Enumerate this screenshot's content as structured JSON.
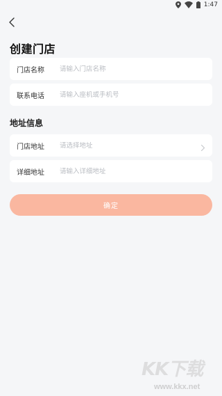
{
  "status_bar": {
    "time": "1:47",
    "icons": [
      "location-icon",
      "wifi-icon",
      "battery-icon"
    ]
  },
  "header": {
    "back_icon": "chevron-left-icon",
    "title": "创建门店"
  },
  "form": {
    "store_name": {
      "label": "门店名称",
      "placeholder": "请输入门店名称",
      "value": ""
    },
    "phone": {
      "label": "联系电话",
      "placeholder": "请输入座机或手机号",
      "value": ""
    }
  },
  "address_section": {
    "title": "地址信息",
    "store_address": {
      "label": "门店地址",
      "placeholder": "请选择地址",
      "value": "",
      "icon": "chevron-right-icon"
    },
    "detail_address": {
      "label": "详细地址",
      "placeholder": "请输入详细地址",
      "value": ""
    }
  },
  "actions": {
    "confirm_label": "确定"
  },
  "colors": {
    "background": "#f5f6f8",
    "card": "#ffffff",
    "primary_button": "#fab7a0",
    "placeholder": "#b9bcc2"
  },
  "watermark": {
    "logo": "KK下载",
    "url": "www.kkx.net"
  }
}
